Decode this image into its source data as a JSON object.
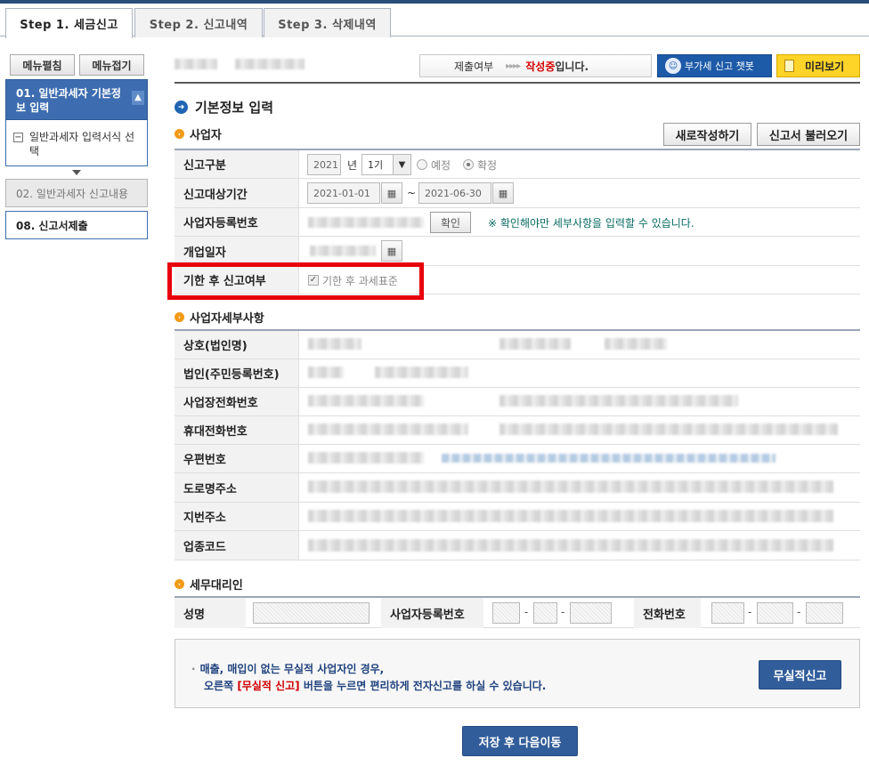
{
  "tabs": [
    {
      "label": "Step 1. 세금신고",
      "active": true
    },
    {
      "label": "Step 2. 신고내역",
      "active": false
    },
    {
      "label": "Step 3. 삭제내역",
      "active": false
    }
  ],
  "sidebar": {
    "expand_all": "메뉴펼침",
    "collapse_all": "메뉴접기",
    "items": [
      {
        "label": "01. 일반과세자 기본정보 입력"
      },
      {
        "label": "일반과세자 입력서식 선택"
      },
      {
        "label": "02. 일반과세자 신고내용"
      },
      {
        "label": "08. 신고서제출"
      }
    ]
  },
  "header": {
    "submit_label": "제출여부",
    "arrows": "▸▸▸▸",
    "status_red": "작성중",
    "status_suffix": "입니다.",
    "chatbot_label": "부가세 신고 챗봇",
    "preview_label": "미리보기"
  },
  "main": {
    "title": "기본정보 입력",
    "business_section": "사업자",
    "new_write_button": "새로작성하기",
    "load_button": "신고서 불러오기",
    "report_type": {
      "label": "신고구분",
      "year": "2021",
      "year_unit": "년",
      "period": "1기",
      "option_preliminary": "예정",
      "option_final": "확정",
      "selected": "확정"
    },
    "period": {
      "label": "신고대상기간",
      "start": "2021-01-01",
      "tilde": "~",
      "end": "2021-06-30"
    },
    "biz_reg": {
      "label": "사업자등록번호",
      "confirm": "확인",
      "note": "※ 확인해야만 세부사항을 입력할 수 있습니다."
    },
    "open_date": {
      "label": "개업일자"
    },
    "late_filing": {
      "label": "기한 후 신고여부",
      "checkbox": "기한 후 과세표준",
      "checked": true
    },
    "detail_section": "사업자세부사항",
    "details": [
      {
        "label": "상호(법인명)"
      },
      {
        "label": "법인(주민등록번호)"
      },
      {
        "label": "사업장전화번호"
      },
      {
        "label": "휴대전화번호"
      },
      {
        "label": "우편번호"
      },
      {
        "label": "도로명주소"
      },
      {
        "label": "지번주소"
      },
      {
        "label": "업종코드"
      }
    ],
    "agent_section": "세무대리인",
    "agent": {
      "name": "성명",
      "biz_reg": "사업자등록번호",
      "phone": "전화번호",
      "dash": "-"
    },
    "notice": {
      "bullet": "·",
      "line1": "매출, 매입이 없는 무실적 사업자인 경우,",
      "line2_pre": "오른쪽 ",
      "line2_red": "[무실적 신고]",
      "line2_post": " 버튼을 누르면 편리하게 전자신고를 하실 수 있습니다.",
      "button": "무실적신고"
    },
    "save_next": "저장 후 다음이동"
  }
}
